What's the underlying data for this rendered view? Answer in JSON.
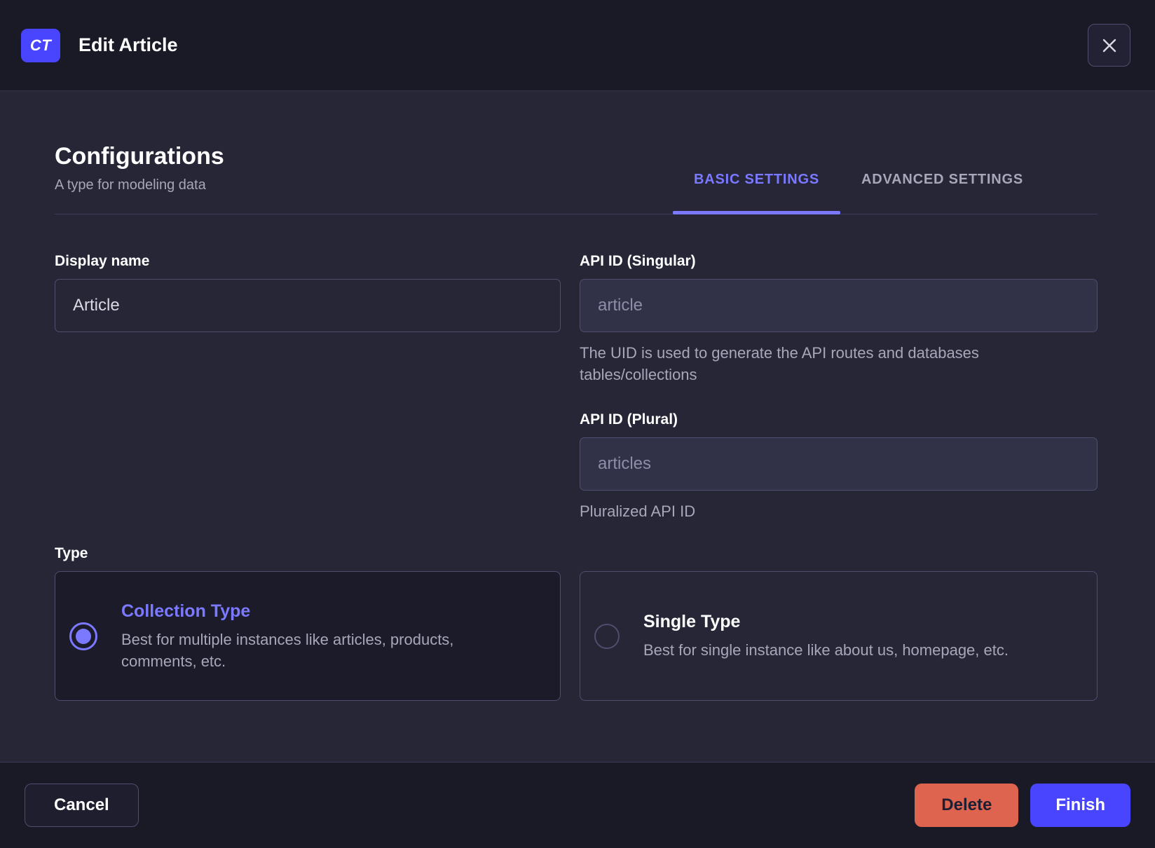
{
  "colors": {
    "accent": "#4945ff",
    "accent_light": "#7b79ff",
    "danger": "#df6450",
    "body_bg": "#262637",
    "chrome_bg": "#1a1a27"
  },
  "header": {
    "badge": "CT",
    "title": "Edit Article"
  },
  "configurations": {
    "title": "Configurations",
    "subtitle": "A type for modeling data",
    "tabs": [
      {
        "label": "BASIC SETTINGS",
        "active": true
      },
      {
        "label": "ADVANCED SETTINGS",
        "active": false
      }
    ]
  },
  "form": {
    "display_name": {
      "label": "Display name",
      "value": "Article"
    },
    "api_id_singular": {
      "label": "API ID (Singular)",
      "value": "article",
      "hint": "The UID is used to generate the API routes and databases tables/collections"
    },
    "api_id_plural": {
      "label": "API ID (Plural)",
      "value": "articles",
      "hint": "Pluralized API ID"
    },
    "type": {
      "label": "Type",
      "options": [
        {
          "title": "Collection Type",
          "description": "Best for multiple instances like articles, products, comments, etc.",
          "selected": true
        },
        {
          "title": "Single Type",
          "description": "Best for single instance like about us, homepage, etc.",
          "selected": false
        }
      ]
    }
  },
  "footer": {
    "cancel_label": "Cancel",
    "delete_label": "Delete",
    "finish_label": "Finish"
  }
}
